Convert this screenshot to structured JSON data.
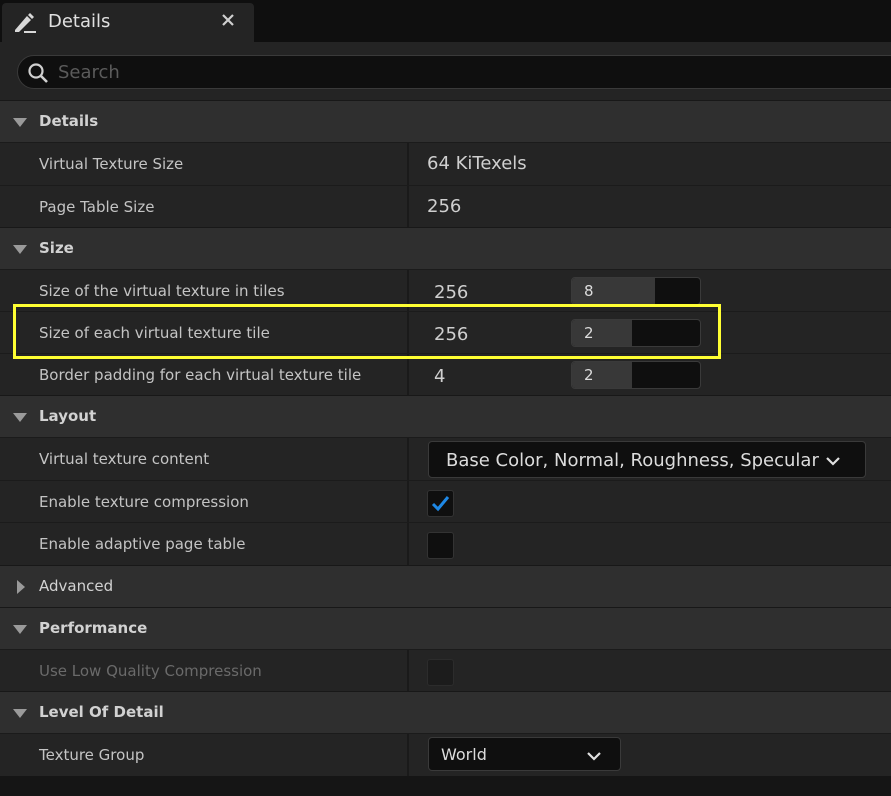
{
  "tab": {
    "title": "Details",
    "icon": "pencil-icon",
    "close_icon": "close-icon"
  },
  "search": {
    "placeholder": "Search",
    "value": ""
  },
  "sections": {
    "details": {
      "label": "Details",
      "virtual_texture_size": {
        "name": "Virtual Texture Size",
        "value": "64 KiTexels"
      },
      "page_table_size": {
        "name": "Page Table Size",
        "value": "256"
      }
    },
    "size": {
      "label": "Size",
      "tiles": {
        "name": "Size of the virtual texture in tiles",
        "computed": "256",
        "input": "8",
        "fill_fraction": 0.65
      },
      "tile_size": {
        "name": "Size of each virtual texture tile",
        "computed": "256",
        "input": "2",
        "fill_fraction": 0.47
      },
      "border": {
        "name": "Border padding for each virtual texture tile",
        "computed": "4",
        "input": "2",
        "fill_fraction": 0.47
      }
    },
    "layout": {
      "label": "Layout",
      "content": {
        "name": "Virtual texture content",
        "value": "Base Color, Normal, Roughness, Specular"
      },
      "compression": {
        "name": "Enable texture compression",
        "checked": true
      },
      "adaptive": {
        "name": "Enable adaptive page table",
        "checked": false
      }
    },
    "advanced": {
      "label": "Advanced",
      "expanded": false
    },
    "performance": {
      "label": "Performance",
      "low_quality": {
        "name": "Use Low Quality Compression",
        "checked": false,
        "disabled": true
      }
    },
    "lod": {
      "label": "Level Of Detail",
      "texture_group": {
        "name": "Texture Group",
        "value": "World"
      }
    }
  },
  "colors": {
    "highlight": "#ffff33",
    "check_accent": "#1e88e5",
    "panel": "#242424",
    "category": "#2f2f2f"
  }
}
